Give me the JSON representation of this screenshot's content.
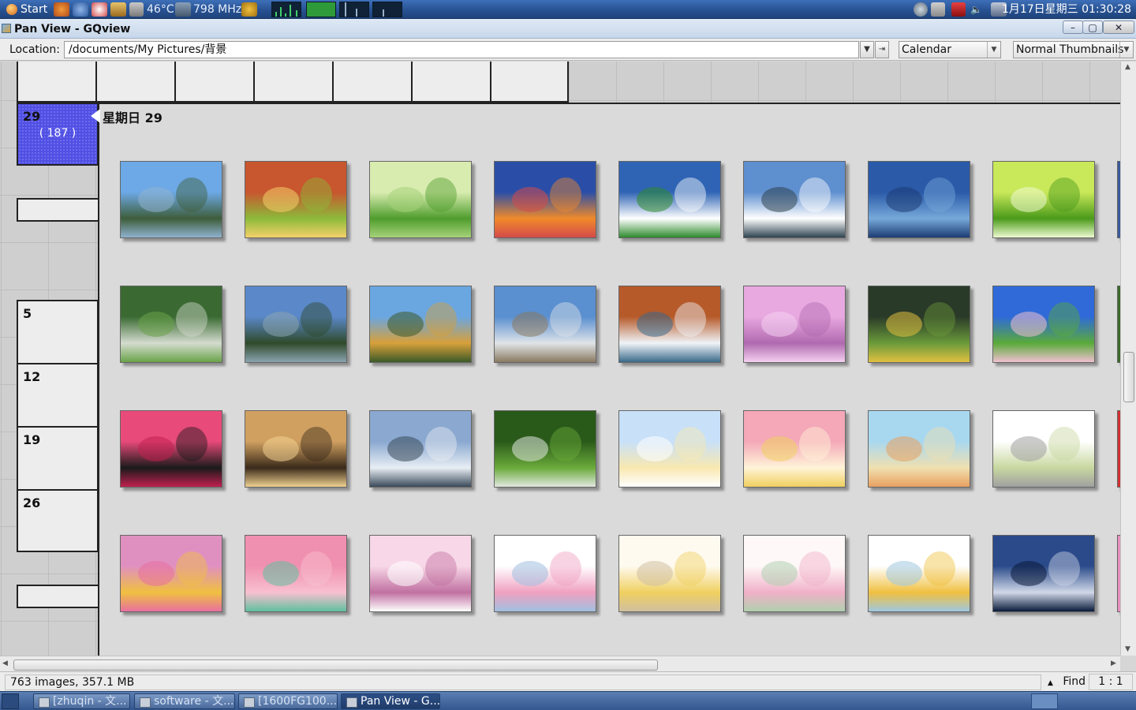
{
  "top_panel": {
    "start_label": "Start",
    "temperature": "46°C",
    "cpu_freq": "798 MHz",
    "clock": "1月17日星期三 01:30:28"
  },
  "window": {
    "title": "Pan View - GQview",
    "minimize": "–",
    "maximize": "▢",
    "close": "✕"
  },
  "location_bar": {
    "label": "Location:",
    "path": "/documents/My Pictures/背景",
    "mode": "Calendar",
    "thumb_size": "Normal Thumbnails"
  },
  "calendar": {
    "days": [
      {
        "day": "29",
        "count": "( 187 )"
      },
      {
        "day": "5"
      },
      {
        "day": "12"
      },
      {
        "day": "19"
      },
      {
        "day": "26"
      }
    ],
    "day_title": "星期日 29"
  },
  "thumbnails": [
    {
      "name": "mountain-lake",
      "colors": [
        "#6da9e6",
        "#3e5d3a",
        "#8fb2d0"
      ]
    },
    {
      "name": "autumn-leaves",
      "colors": [
        "#c8562e",
        "#8cba3a",
        "#f4d06a"
      ]
    },
    {
      "name": "green-leaves",
      "colors": [
        "#d9ecb0",
        "#4f9d2d",
        "#a6d27a"
      ]
    },
    {
      "name": "sunset-sea",
      "colors": [
        "#2a4ea8",
        "#f08a2a",
        "#d44a4a"
      ]
    },
    {
      "name": "cloudy-field",
      "colors": [
        "#2f64b4",
        "#ffffff",
        "#2d8a2d"
      ]
    },
    {
      "name": "snow-forest",
      "colors": [
        "#5e8fcf",
        "#ffffff",
        "#2f4450"
      ]
    },
    {
      "name": "blue-reeds",
      "colors": [
        "#2a5aa8",
        "#77a9da",
        "#1d3d75"
      ]
    },
    {
      "name": "leaves-light",
      "colors": [
        "#c9e85a",
        "#4a9a1a",
        "#eefad0"
      ]
    },
    {
      "name": "forest-stream",
      "colors": [
        "#3a6a32",
        "#d4dccf",
        "#6aa34a"
      ]
    },
    {
      "name": "alpine-lake",
      "colors": [
        "#5a88c8",
        "#2f4a2a",
        "#8aa4b0"
      ]
    },
    {
      "name": "hay-bales",
      "colors": [
        "#6aa6e0",
        "#d8a03a",
        "#3c5a28"
      ]
    },
    {
      "name": "terraces",
      "colors": [
        "#5a8fd0",
        "#e0e4e8",
        "#8a7a60"
      ]
    },
    {
      "name": "waterfall",
      "colors": [
        "#b65a2a",
        "#f0f4f8",
        "#3a6a8a"
      ]
    },
    {
      "name": "pink-tree",
      "colors": [
        "#e8a8e0",
        "#b06ab0",
        "#f4d0f0"
      ]
    },
    {
      "name": "mossy-stream",
      "colors": [
        "#2a3a28",
        "#6a9a3a",
        "#e0c040"
      ]
    },
    {
      "name": "blossom-hill",
      "colors": [
        "#2f6ad8",
        "#5aaa3a",
        "#f0c0d0"
      ]
    },
    {
      "name": "palm-sunset",
      "colors": [
        "#e84a7a",
        "#1a1a1a",
        "#c02050"
      ]
    },
    {
      "name": "savanna-trees",
      "colors": [
        "#d0a060",
        "#3a2a1a",
        "#f0d090"
      ]
    },
    {
      "name": "mountain-reflection",
      "colors": [
        "#8aa8d0",
        "#e8eef4",
        "#3a4a5a"
      ]
    },
    {
      "name": "green-waterfall",
      "colors": [
        "#2a5a1a",
        "#6aaa3a",
        "#e0e8e0"
      ]
    },
    {
      "name": "cartoon-bunny",
      "colors": [
        "#c8e0f8",
        "#f8e8b0",
        "#ffffff"
      ]
    },
    {
      "name": "cartoon-girl",
      "colors": [
        "#f4a8b8",
        "#fff4d8",
        "#f0d060"
      ]
    },
    {
      "name": "cartoon-sky",
      "colors": [
        "#a8d8f0",
        "#f0e0b0",
        "#e8a060"
      ]
    },
    {
      "name": "cartoon-kids",
      "colors": [
        "#ffffff",
        "#c8d8a0",
        "#a0a0a0"
      ]
    },
    {
      "name": "cartoon-dog",
      "colors": [
        "#e090c0",
        "#f0c040",
        "#e870a0"
      ]
    },
    {
      "name": "pink-bunnies",
      "colors": [
        "#f090b0",
        "#f8c0d0",
        "#60c0a0"
      ]
    },
    {
      "name": "bottle-fairy",
      "colors": [
        "#f8d8e8",
        "#c070a0",
        "#ffffff"
      ]
    },
    {
      "name": "cartoon-clothesline",
      "colors": [
        "#ffffff",
        "#f0a0c0",
        "#a0c0e0"
      ]
    },
    {
      "name": "cartoon-yellow",
      "colors": [
        "#fffaf0",
        "#f0d060",
        "#d0c0a0"
      ]
    },
    {
      "name": "cartoon-pink-hair",
      "colors": [
        "#fff8f8",
        "#f0b0c8",
        "#b0d0b0"
      ]
    },
    {
      "name": "cartoon-frame",
      "colors": [
        "#ffffff",
        "#f0c040",
        "#a0c8e0"
      ]
    },
    {
      "name": "clock-figure",
      "colors": [
        "#2a4a8a",
        "#d0d8e8",
        "#0a1a3a"
      ]
    }
  ],
  "status_bar": {
    "info": "763 images, 357.1 MB",
    "find_label": "Find",
    "zoom": "1 : 1"
  },
  "taskbar": {
    "tasks": [
      "[zhuqin - 文...",
      "software - 文...",
      "[1600FG100...",
      "Pan View - G..."
    ]
  }
}
